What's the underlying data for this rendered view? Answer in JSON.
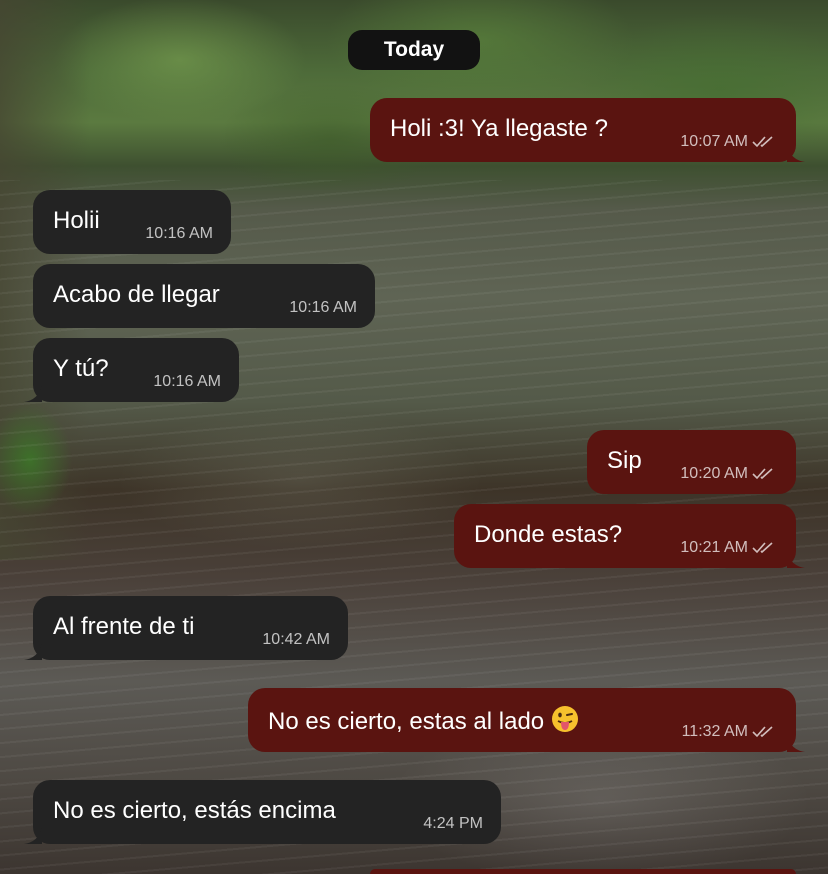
{
  "date_separator": "Today",
  "colors": {
    "incoming_bubble": "#232323",
    "outgoing_bubble": "#5a1410",
    "date_pill": "#121212"
  },
  "messages": [
    {
      "direction": "outgoing",
      "text": "Holi :3! Ya llegaste ?",
      "time": "10:07 AM",
      "status": "read"
    },
    {
      "direction": "incoming",
      "text": "Holii",
      "time": "10:16 AM"
    },
    {
      "direction": "incoming",
      "text": "Acabo de llegar",
      "time": "10:16 AM"
    },
    {
      "direction": "incoming",
      "text": "Y tú?",
      "time": "10:16 AM"
    },
    {
      "direction": "outgoing",
      "text": "Sip",
      "time": "10:20 AM",
      "status": "read"
    },
    {
      "direction": "outgoing",
      "text": "Donde estas?",
      "time": "10:21 AM",
      "status": "read"
    },
    {
      "direction": "incoming",
      "text": "Al frente de ti",
      "time": "10:42 AM"
    },
    {
      "direction": "outgoing",
      "text": "No es cierto, estas al lado",
      "emoji": "tongue-out-emoji",
      "time": "11:32 AM",
      "status": "read"
    },
    {
      "direction": "incoming",
      "text": "No es cierto, estás encima",
      "time": "4:24 PM"
    }
  ]
}
